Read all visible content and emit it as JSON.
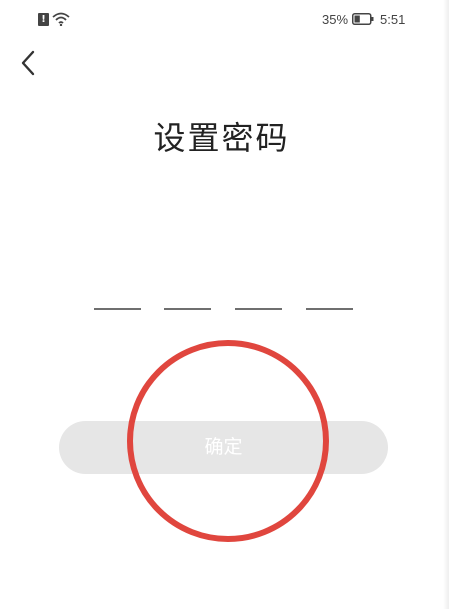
{
  "status_bar": {
    "sim_glyph": "!",
    "battery_percent": "35%",
    "time": "5:51",
    "battery_level": 0.35
  },
  "header": {
    "back_icon": "chevron-left-icon"
  },
  "title": "设置密码",
  "pin": {
    "slots": 4,
    "digits": [
      "",
      "",
      "",
      ""
    ]
  },
  "confirm_label": "确定",
  "annotation": {
    "circle_color": "#e0463e"
  },
  "colors": {
    "button_bg": "#e6e6e6",
    "button_text": "#ffffff",
    "title_text": "#222222",
    "slot_line": "#6f6f6f"
  }
}
